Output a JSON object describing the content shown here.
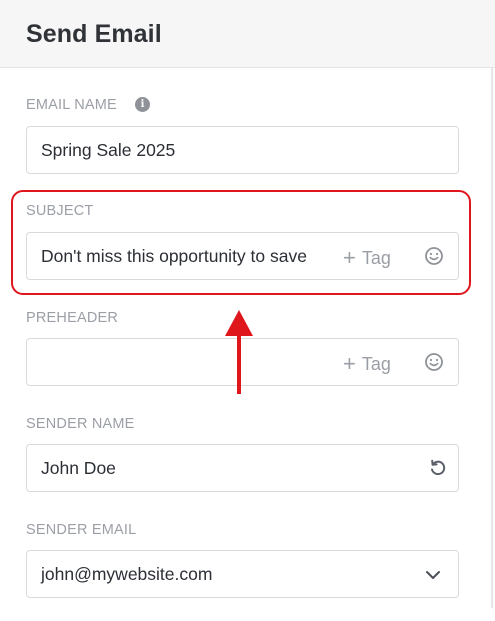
{
  "header": {
    "title": "Send Email"
  },
  "email_name": {
    "label": "EMAIL NAME",
    "value": "Spring Sale 2025"
  },
  "subject": {
    "label": "SUBJECT",
    "value": "Don't miss this opportunity to save",
    "tag_label": "Tag"
  },
  "preheader": {
    "label": "PREHEADER",
    "value": "",
    "tag_label": "Tag"
  },
  "sender_name": {
    "label": "SENDER NAME",
    "value": "John Doe"
  },
  "sender_email": {
    "label": "SENDER EMAIL",
    "value": "john@mywebsite.com"
  },
  "colors": {
    "annotation": "#e0161d",
    "label": "#9b9fa6",
    "border": "#d8dadd",
    "header_bg": "#f6f6f6"
  },
  "icons": [
    "info-icon",
    "plus-icon",
    "emoji-icon",
    "reset-icon",
    "chevron-down-icon",
    "arrow-up-icon"
  ]
}
